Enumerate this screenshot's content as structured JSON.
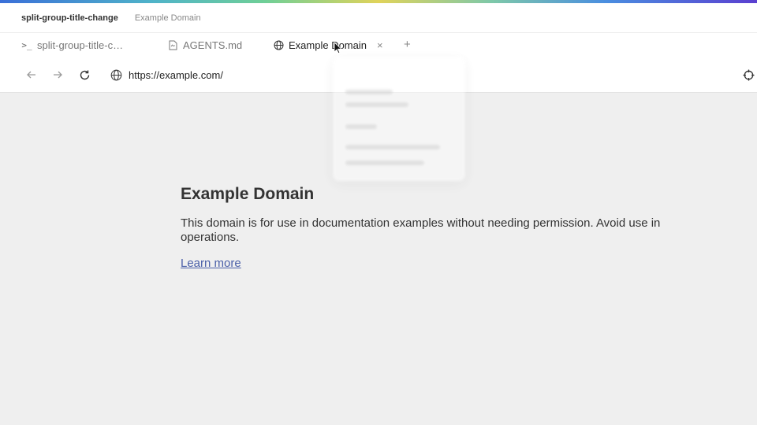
{
  "window": {
    "breadcrumb": [
      "split-group-title-change",
      "Example Domain"
    ]
  },
  "tabs": [
    {
      "label": "split-group-title-c…",
      "icon": "terminal-icon",
      "active": false
    },
    {
      "label": "AGENTS.md",
      "icon": "file-icon",
      "active": false
    },
    {
      "label": "Example Domain",
      "icon": "globe-icon",
      "active": true
    }
  ],
  "tab_actions": {
    "close": "×",
    "add": "+"
  },
  "nav": {
    "back_icon": "arrow-left-icon",
    "forward_icon": "arrow-right-icon",
    "reload_icon": "reload-icon",
    "url": "https://example.com/",
    "target_icon": "crosshair-icon"
  },
  "page": {
    "heading": "Example Domain",
    "paragraph": "This domain is for use in documentation examples without needing permission. Avoid use in operations.",
    "link": "Learn more"
  },
  "colors": {
    "accent_start": "#3a6fd8",
    "accent_end": "#5a3fd0",
    "link": "#4a5fa8",
    "page_bg": "#efefef"
  }
}
